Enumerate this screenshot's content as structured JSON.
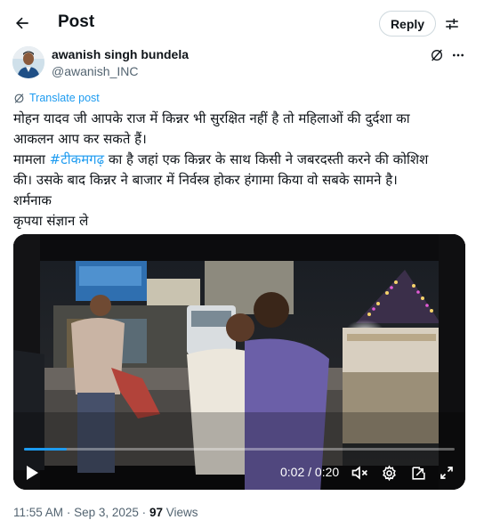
{
  "header": {
    "title": "Post",
    "reply_label": "Reply"
  },
  "author": {
    "name": "awanish singh bundela",
    "handle": "@awanish_INC"
  },
  "translate_label": "Translate post",
  "tweet": {
    "line1": "मोहन यादव जी आपके राज में किन्नर भी सुरक्षित नहीं है तो महिलाओं की दुर्दशा का",
    "line2": "आकलन आप कर सकते हैं।",
    "line3_prefix": "मामला ",
    "hashtag": "#टीकमगढ़",
    "line3_suffix": " का है जहां एक किन्नर के साथ किसी ने जबरदस्ती करने की कोशिश",
    "line4": "की। उसके बाद किन्नर ने बाजार में निर्वस्त्र होकर हंगामा किया वो सबके सामने है।",
    "line5": "शर्मनाक",
    "line6": "कृपया संज्ञान ले"
  },
  "video": {
    "time_readout": "0:02 / 0:20",
    "progress_fraction": 0.1
  },
  "meta": {
    "time": "11:55 AM",
    "separator": "·",
    "date": "Sep 3, 2025",
    "views_count": "97",
    "views_label": "Views"
  },
  "colors": {
    "accent": "#1d9bf0",
    "text": "#0f1419",
    "secondary": "#536471"
  },
  "icons": {
    "back": "arrow-left-icon",
    "adjust": "sliders-icon",
    "grok": "grok-icon",
    "more": "more-dots-icon",
    "translate": "translate-icon",
    "play": "play-icon",
    "mute": "volume-muted-icon",
    "settings": "settings-gear-icon",
    "popout": "popout-icon",
    "fullscreen": "fullscreen-icon"
  }
}
